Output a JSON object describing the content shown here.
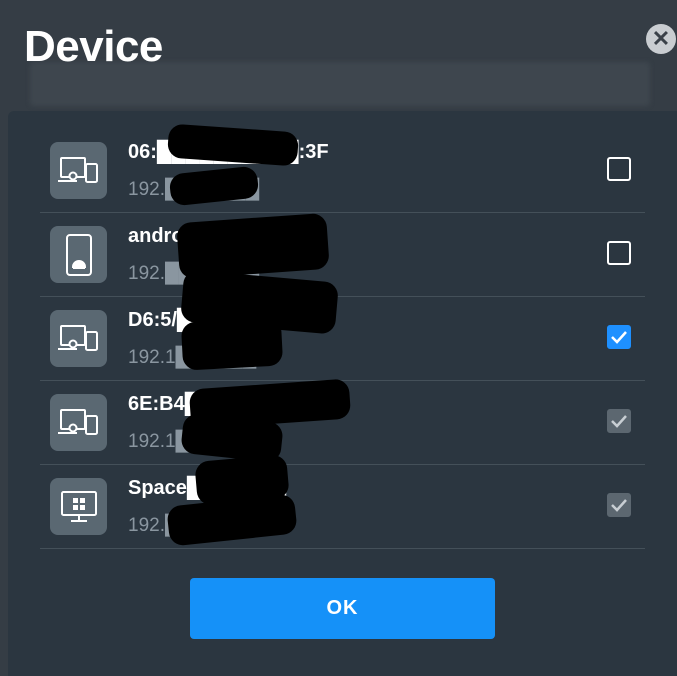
{
  "dialog": {
    "title": "Device",
    "close_icon": "close-icon",
    "ok_label": "OK"
  },
  "devices": [
    {
      "name": "06:██████████:3F",
      "ip": "192.███████",
      "icon": "devices-icon",
      "state": "unchecked"
    },
    {
      "name": "androi███████",
      "ip": "192.███████",
      "icon": "android-phone-icon",
      "state": "unchecked"
    },
    {
      "name": "D6:5/███████",
      "ip": "192.1██████",
      "icon": "devices-icon",
      "state": "checked"
    },
    {
      "name": "6E:B4███████",
      "ip": "192.1██████",
      "icon": "devices-icon",
      "state": "checked-disabled"
    },
    {
      "name": "Space███████",
      "ip": "192.███████",
      "icon": "windows-desktop-icon",
      "state": "checked-disabled"
    }
  ],
  "colors": {
    "accent": "#1591f8",
    "panel": "#2b3640",
    "icon_bg": "#5a6872"
  }
}
